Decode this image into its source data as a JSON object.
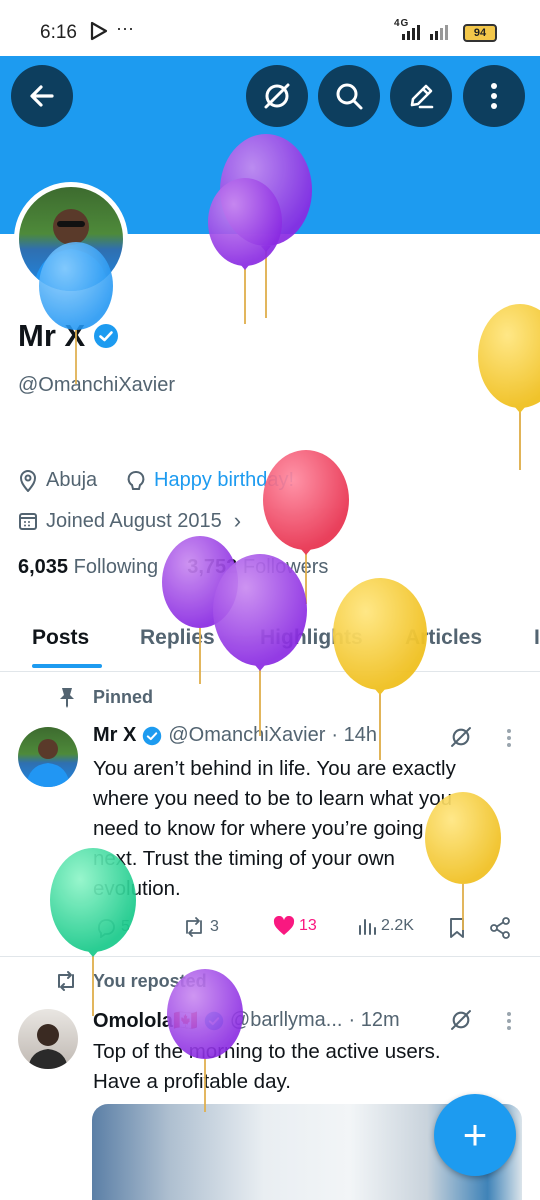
{
  "status_bar": {
    "time": "6:16",
    "network": "4G",
    "battery": "94"
  },
  "banner": {
    "color": "#1d9bf0"
  },
  "profile": {
    "name": "Mr X",
    "handle": "@OmanchiXavier",
    "location": "Abuja",
    "website": "Happy birthday!",
    "joined": "Joined August 2015",
    "following_count": "6,035",
    "following_label": "Following",
    "followers_count": "3,752",
    "followers_label": "Followers"
  },
  "tabs": [
    {
      "label": "Posts",
      "active": true
    },
    {
      "label": "Replies"
    },
    {
      "label": "Highlights"
    },
    {
      "label": "Articles"
    }
  ],
  "pinned_post": {
    "label": "Pinned",
    "author": "Mr X",
    "handle": "@OmanchiXavier",
    "time": "· 14h",
    "lines": [
      "You aren’t behind in life. You are exactly",
      "where you need to be to learn what you",
      "need to know for where you’re going",
      "next. Trust the timing of your own",
      "evolution."
    ],
    "replies": "5",
    "reposts": "3",
    "likes": "13",
    "views": "2.2K"
  },
  "repost": {
    "label": "You reposted",
    "author": "Omolola🇨🇦",
    "handle": "@barllyma...",
    "time": "· 12m",
    "lines": [
      "Top of the morning to the active users.",
      "Have a profitable day."
    ]
  },
  "fab": {
    "label": "+"
  },
  "colors": {
    "accent": "#1d9bf0",
    "like": "#f91880",
    "dark_button": "#0d3e5e"
  },
  "icons": [
    "back-arrow-icon",
    "grok-icon",
    "search-icon",
    "edit-icon",
    "more-vertical-icon",
    "location-icon",
    "bulb-icon",
    "calendar-icon",
    "verified-icon",
    "pin-icon",
    "repost-icon",
    "reply-icon",
    "heart-icon",
    "views-icon",
    "bookmark-icon",
    "share-icon"
  ]
}
